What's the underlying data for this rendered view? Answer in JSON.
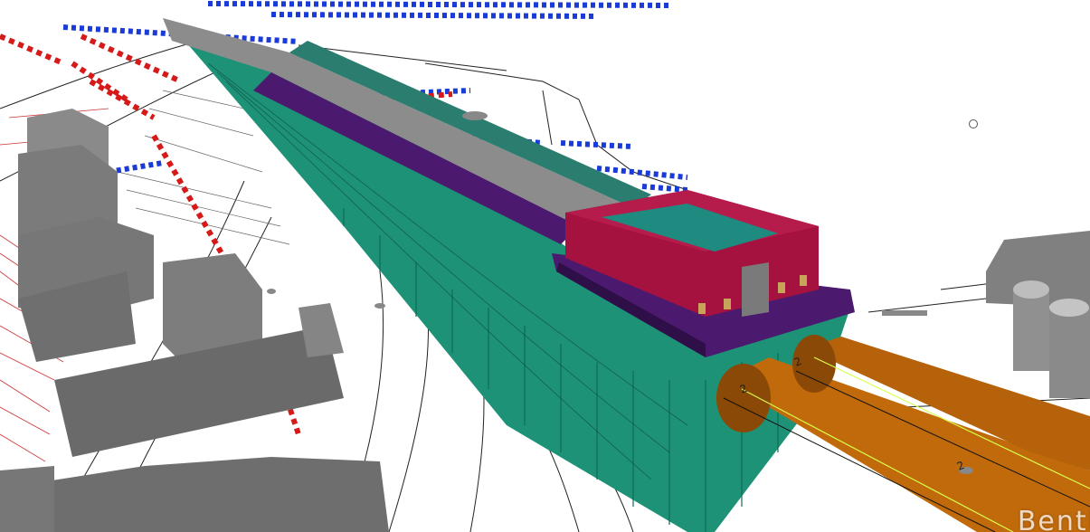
{
  "viewer": {
    "watermark": "Bentl",
    "tunnel_labels": [
      "2",
      "2",
      "2"
    ],
    "colors": {
      "pile_wall": "#1d9277",
      "pile_wall_dark": "#0f6b55",
      "roof_slab": "#4b1a6e",
      "box_building": "#a5123f",
      "box_roof": "#1e8a80",
      "tunnel": "#c06a0c",
      "tunnel_dark": "#8a4906",
      "buildings": "#7b7b7b",
      "utility_blue": "#1a3bd6",
      "utility_red": "#d61a1a"
    },
    "icons": {
      "orbit_cursor": "orbit-target-icon"
    }
  }
}
